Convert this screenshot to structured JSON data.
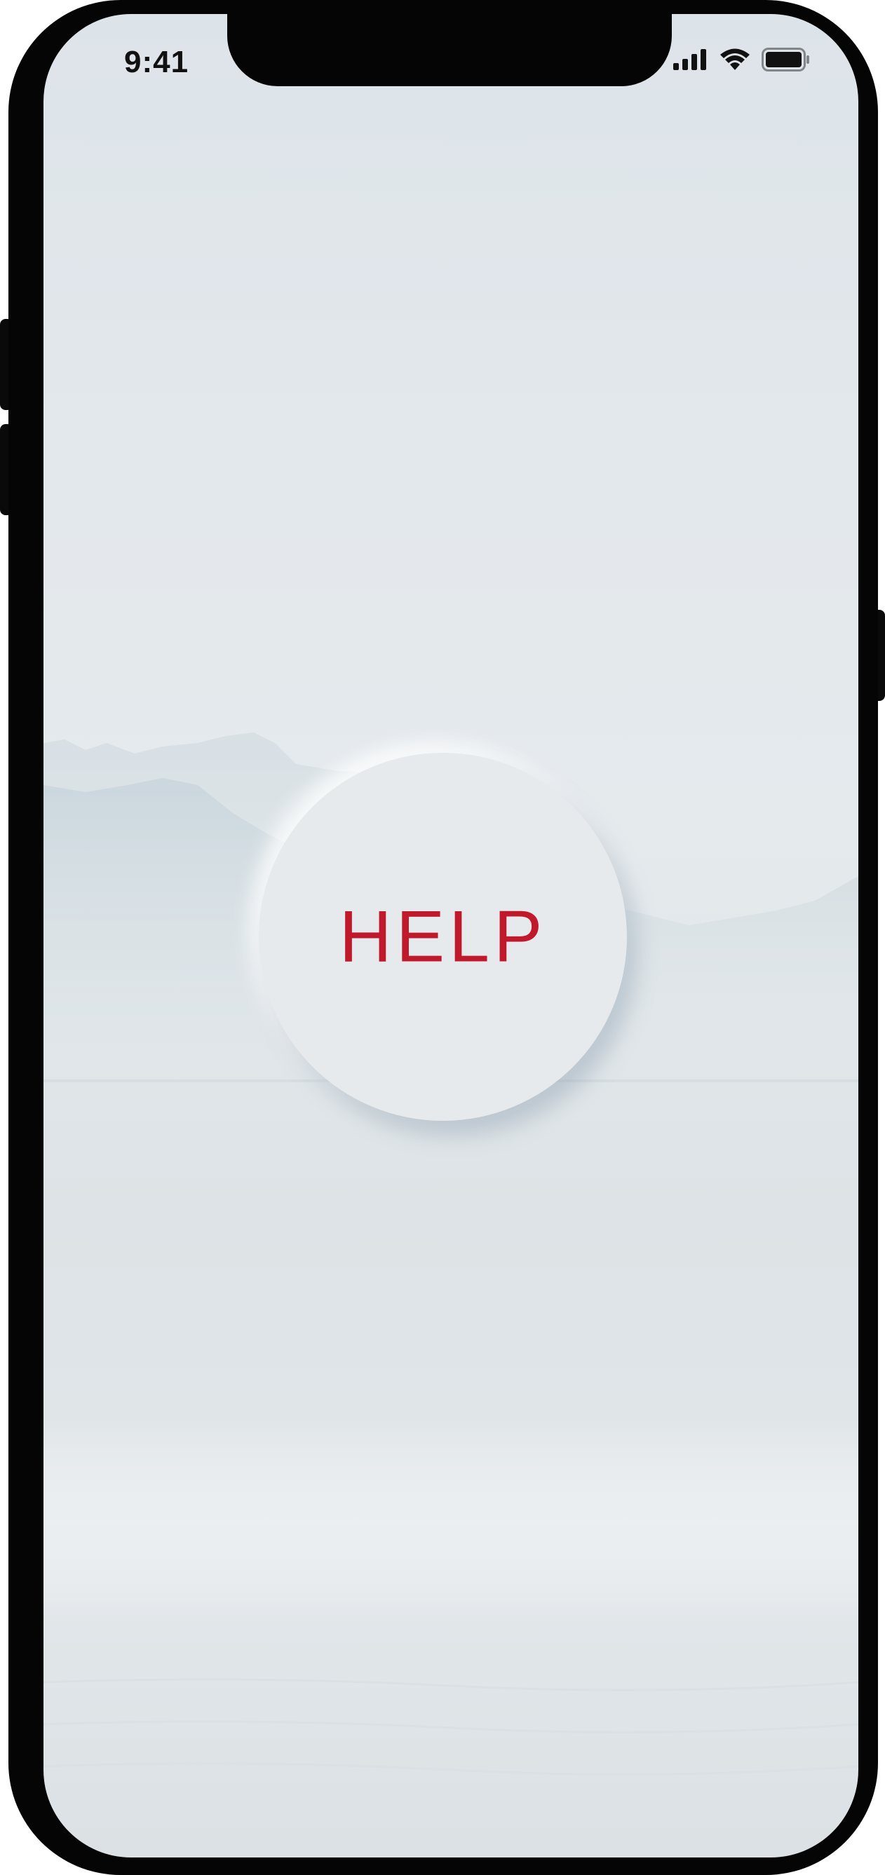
{
  "status_bar": {
    "time": "9:41",
    "icons": [
      "cellular-signal-icon",
      "wifi-icon",
      "battery-icon"
    ]
  },
  "main": {
    "help_button_label": "HELP"
  },
  "colors": {
    "accent": "#c0192b",
    "button_surface": "#e6eaed",
    "background": "#e3e8ec",
    "device_frame": "#050505"
  }
}
